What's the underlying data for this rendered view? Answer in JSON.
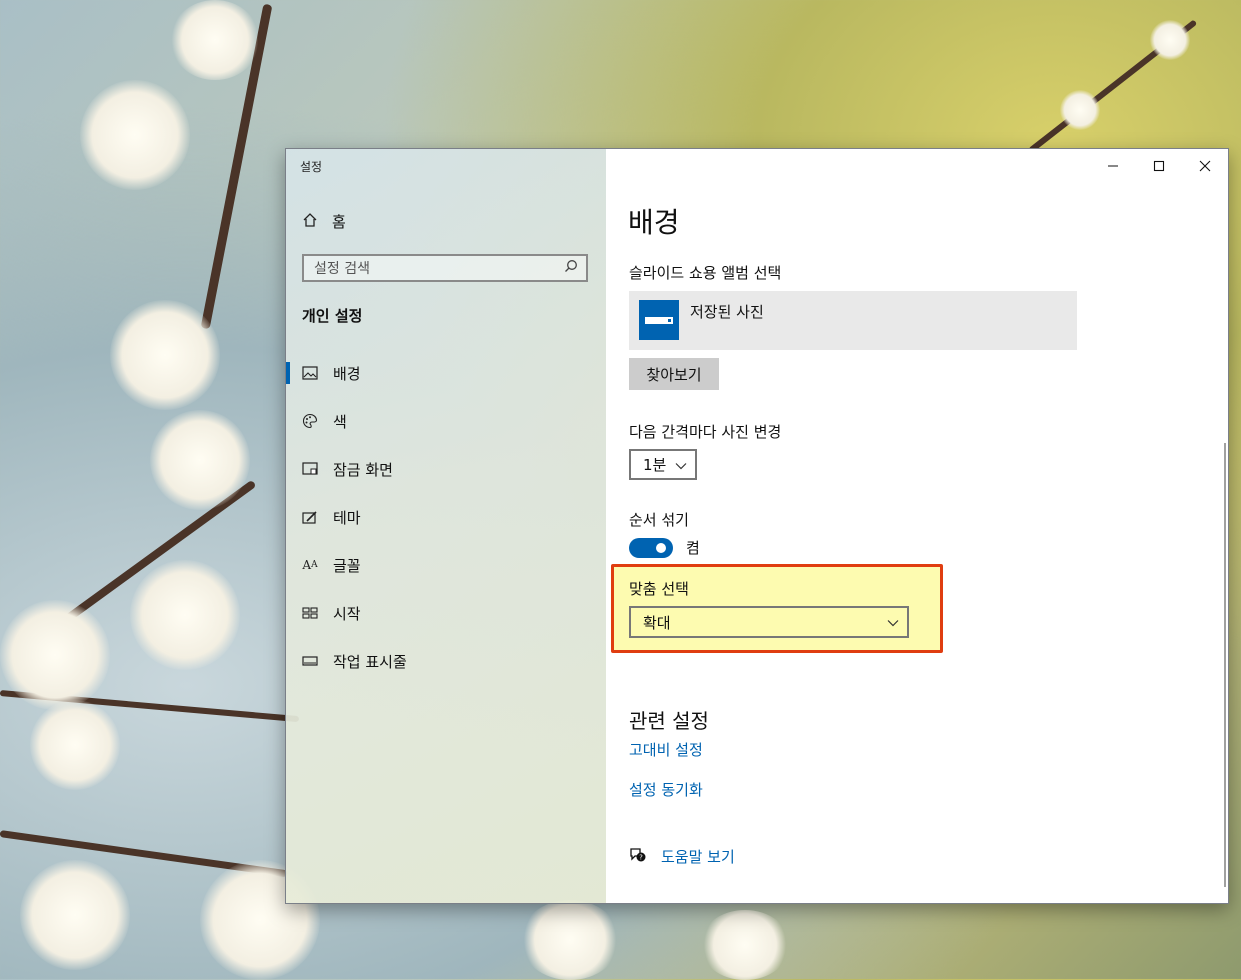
{
  "window": {
    "title": "설정",
    "controls": [
      "minimize",
      "maximize",
      "close"
    ]
  },
  "nav": {
    "home_label": "홈",
    "search_placeholder": "설정 검색",
    "section_title": "개인 설정",
    "items": [
      {
        "label": "배경",
        "icon": "picture-icon",
        "selected": true
      },
      {
        "label": "색",
        "icon": "palette-icon",
        "selected": false
      },
      {
        "label": "잠금 화면",
        "icon": "lock-screen-icon",
        "selected": false
      },
      {
        "label": "테마",
        "icon": "theme-brush-icon",
        "selected": false
      },
      {
        "label": "글꼴",
        "icon": "font-icon",
        "selected": false
      },
      {
        "label": "시작",
        "icon": "start-grid-icon",
        "selected": false
      },
      {
        "label": "작업 표시줄",
        "icon": "taskbar-icon",
        "selected": false
      }
    ]
  },
  "content": {
    "page_title": "배경",
    "album_label": "슬라이드 쇼용 앨범 선택",
    "album_name": "저장된 사진",
    "browse_label": "찾아보기",
    "interval_label": "다음 간격마다 사진 변경",
    "interval_value": "1분",
    "shuffle_label": "순서 섞기",
    "shuffle_state": "켬",
    "shuffle_on": true,
    "fit_label": "맞춤 선택",
    "fit_value": "확대",
    "related_title": "관련 설정",
    "links": [
      "고대비 설정",
      "설정 동기화"
    ],
    "help_label": "도움말 보기"
  },
  "colors": {
    "accent": "#0063b1",
    "highlight_fill": "#fdfbb0",
    "highlight_border": "#e03d10"
  }
}
